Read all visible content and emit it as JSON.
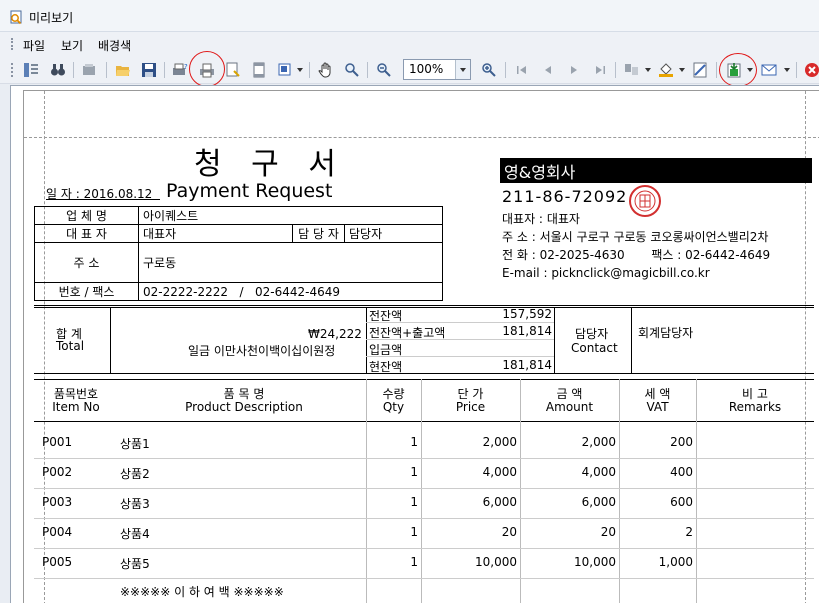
{
  "window": {
    "title": "미리보기"
  },
  "menu": {
    "file": "파일",
    "view": "보기",
    "background": "배경색"
  },
  "toolbar": {
    "zoom": "100%"
  },
  "invoice": {
    "title": "청 구 서",
    "subtitle": "Payment Request",
    "date_label": "일  자 :",
    "date": "2016.08.12",
    "customer": {
      "company_label": "업 체 명",
      "company": "아이퀘스트",
      "rep_label": "대 표 자",
      "rep": "대표자",
      "manager_label": "담 당 자",
      "manager": "담당자",
      "addr_label": "주    소",
      "addr": "구로동",
      "phone_label": "번호 / 팩스",
      "phone": "02-2222-2222",
      "phone_sep": "/",
      "fax": "02-6442-4649"
    },
    "supplier": {
      "name": "영&영회사",
      "bizno": "211-86-72092",
      "rep_label": "대표자 :",
      "rep": "대표자",
      "addr_label": "주   소 :",
      "addr": "서울시 구로구 구로동 코오롱싸이언스밸리2차",
      "tel_label": "전   화 :",
      "tel": "02-2025-4630",
      "fax_label": "팩스 :",
      "fax": "02-6442-4649",
      "email_label": "E-mail :",
      "email": "picknclick@magicbill.co.kr"
    },
    "summary": {
      "total_label": "합  계",
      "total_en": "Total",
      "amount": "₩24,222",
      "amount_words": "일금 이만사천이백이십이원정",
      "rows": [
        {
          "label": "전잔액",
          "value": "157,592"
        },
        {
          "label": "전잔액+출고액",
          "value": "181,814"
        },
        {
          "label": "입금액",
          "value": ""
        },
        {
          "label": "현잔액",
          "value": "181,814"
        }
      ],
      "contact_label": "담당자",
      "contact_en": "Contact",
      "contact_value": "회계담당자"
    },
    "headers": [
      {
        "ko": "품목번호",
        "en": "Item No"
      },
      {
        "ko": "품 목 명",
        "en": "Product Description"
      },
      {
        "ko": "수량",
        "en": "Qty"
      },
      {
        "ko": "단   가",
        "en": "Price"
      },
      {
        "ko": "금   액",
        "en": "Amount"
      },
      {
        "ko": "세   액",
        "en": "VAT"
      },
      {
        "ko": "비   고",
        "en": "Remarks"
      }
    ],
    "items": [
      {
        "no": "P001",
        "name": "상품1",
        "qty": "1",
        "price": "2,000",
        "amount": "2,000",
        "vat": "200"
      },
      {
        "no": "P002",
        "name": "상품2",
        "qty": "1",
        "price": "4,000",
        "amount": "4,000",
        "vat": "400"
      },
      {
        "no": "P003",
        "name": "상품3",
        "qty": "1",
        "price": "6,000",
        "amount": "6,000",
        "vat": "600"
      },
      {
        "no": "P004",
        "name": "상품4",
        "qty": "1",
        "price": "20",
        "amount": "20",
        "vat": "2"
      },
      {
        "no": "P005",
        "name": "상품5",
        "qty": "1",
        "price": "10,000",
        "amount": "10,000",
        "vat": "1,000"
      }
    ],
    "end_note": "※※※※※ 이 하 여 백 ※※※※※"
  }
}
